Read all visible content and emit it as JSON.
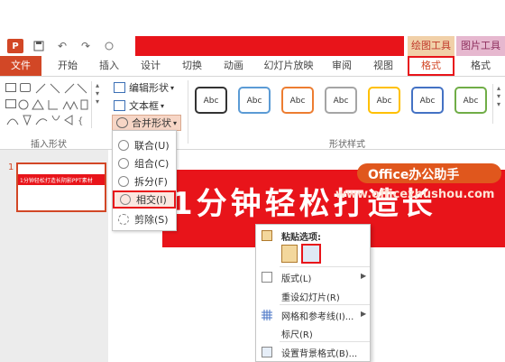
{
  "quick_access": {
    "logo": "P",
    "undo_glyph": "↶",
    "redo_glyph": "↷"
  },
  "contextual_tabs": {
    "drawing_tools": "绘图工具",
    "picture_tools": "图片工具"
  },
  "tabs": [
    "文件",
    "开始",
    "插入",
    "设计",
    "切换",
    "动画",
    "幻灯片放映",
    "审阅",
    "视图",
    "格式",
    "格式"
  ],
  "ribbon": {
    "edit_shape": "编辑形状",
    "text_box": "文本框",
    "merge_shapes": "合并形状",
    "insert_shapes_group": "插入形状",
    "shape_styles_group": "形状样式",
    "style_sample": "Abc"
  },
  "merge_menu": [
    "联合(U)",
    "组合(C)",
    "拆分(F)",
    "相交(I)",
    "剪除(S)"
  ],
  "slide": {
    "number": "1",
    "thumb_text": "1分钟轻松打造长阴影PPT素材",
    "title": "1分钟轻松打造长"
  },
  "watermark": {
    "title": "Office办公助手",
    "url": "www.officezhushou.com"
  },
  "context_menu": {
    "paste_options": "粘贴选项:",
    "layout": "版式(L)",
    "reset_slide": "重设幻灯片(R)",
    "grid_guides": "网格和参考线(I)...",
    "ruler": "标尺(R)",
    "bg_format": "设置背景格式(B)..."
  },
  "colors": {
    "brand": "#d24726",
    "banner_red": "#e8141a",
    "watermark": "#e0571d"
  }
}
